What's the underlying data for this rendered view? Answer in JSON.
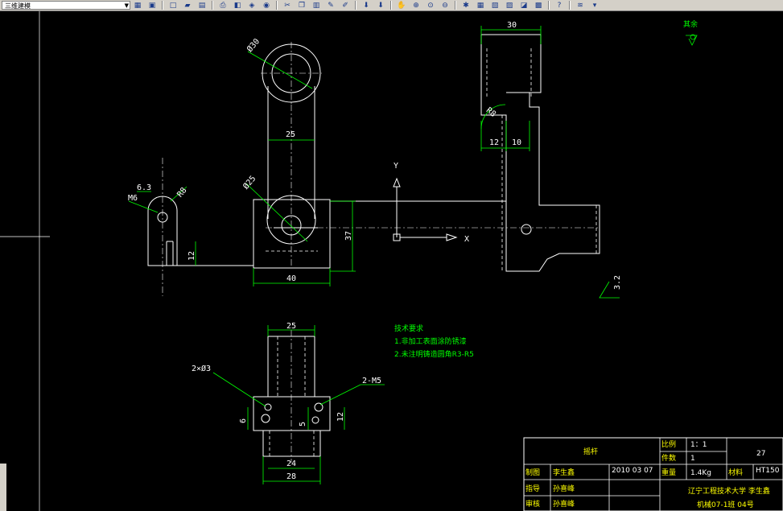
{
  "toolbar": {
    "layer_name": "三维建模",
    "icons": [
      "layer-icon",
      "layer-prev-icon",
      "new-icon",
      "open-icon",
      "save-icon",
      "print-icon",
      "preview-icon",
      "publish-icon",
      "plot-icon",
      "cut-icon",
      "copy-icon",
      "paste-icon",
      "match-icon",
      "brush-icon",
      "undo-icon",
      "redo-icon",
      "pan-icon",
      "zoom-realtime-icon",
      "zoom-window-icon",
      "zoom-prev-icon",
      "properties-icon",
      "design-center-icon",
      "tool-palette-icon",
      "sheet-set-icon",
      "markup-icon",
      "calc-icon",
      "help-icon",
      "layers-icon",
      "more-icon"
    ]
  },
  "drawing": {
    "dims": {
      "d30": "Ø30",
      "d25a": "25",
      "d25b": "Ø25",
      "d40": "40",
      "d37": "37",
      "d12a": "12",
      "d63": "6.3",
      "m6": "M6",
      "r8": "R8",
      "d30top": "30",
      "r8b": "R8",
      "d12b": "12",
      "d10": "10",
      "d25c": "25",
      "d2x3": "2×Ø3",
      "d2m5": "2-M5",
      "d6": "6",
      "d5": "5",
      "d12c": "12",
      "d24": "24",
      "d28": "28",
      "axis_y": "Y",
      "axis_x": "X",
      "rough": "3.2",
      "other": "其余"
    },
    "notes": {
      "title": "技术要求",
      "line1": "1.非加工表面涂防锈漆",
      "line2": "2.未注明铸造圆角R3-R5"
    },
    "title_block": {
      "part": "摇杆",
      "scale_label": "比例",
      "scale": "1：1",
      "qty_label": "件数",
      "qty": "1",
      "drawing_no": "27",
      "drawn_label": "制图",
      "drawn_by": "李生鑫",
      "date": "2010 03 07",
      "weight_label": "重量",
      "weight": "1.4Kg",
      "material_label": "材料",
      "material": "HT150",
      "guide_label": "指导",
      "guide_by": "孙喜峰",
      "check_label": "审核",
      "check_by": "孙喜峰",
      "school": "辽宁工程技术大学 李生鑫",
      "class": "机械07-1班 04号"
    }
  },
  "colors": {
    "background": "#000000",
    "geometry": "#ffffff",
    "dimension": "#00ff00",
    "title_text": "#ffff00"
  }
}
